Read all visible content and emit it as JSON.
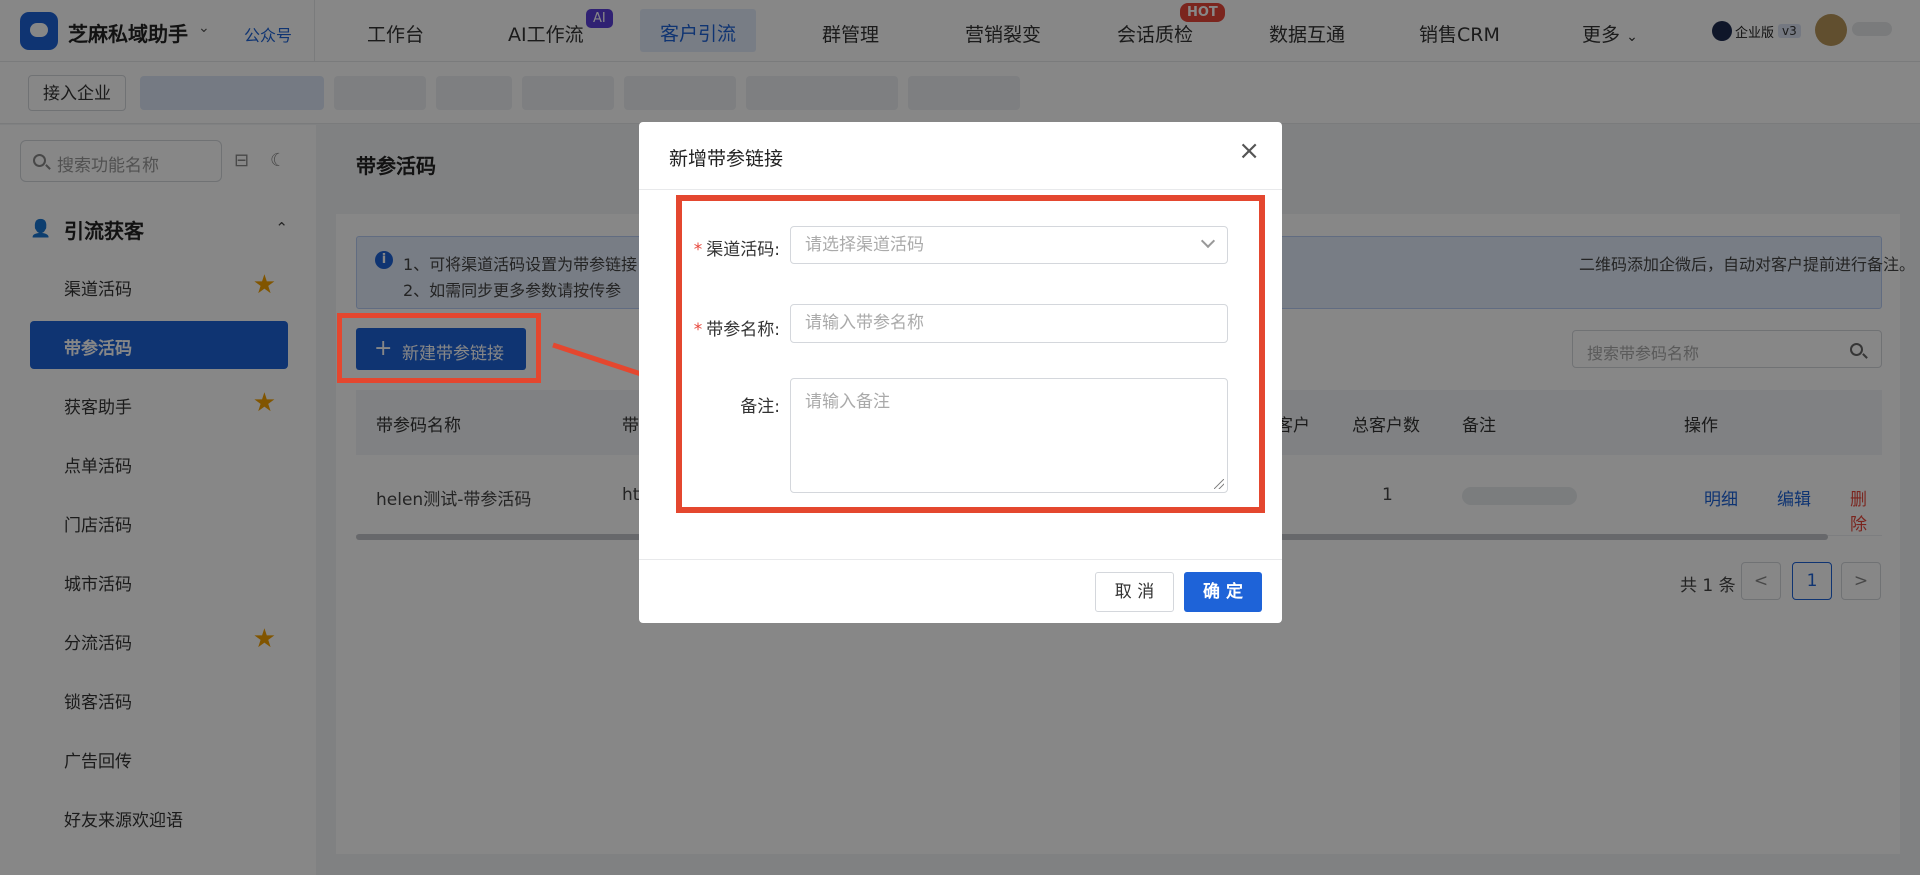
{
  "header": {
    "brand": "芝麻私域助手",
    "official_account": "公众号",
    "nav": [
      "工作台",
      "AI工作流",
      "客户引流",
      "群管理",
      "营销裂变",
      "会话质检",
      "数据互通",
      "销售CRM",
      "更多"
    ],
    "ai_badge": "AI",
    "hot_badge": "HOT",
    "enterprise_label": "企业版",
    "version": "v3"
  },
  "subbar": {
    "join_label": "接入企业"
  },
  "sidebar": {
    "search_placeholder": "搜索功能名称",
    "section_title": "引流获客",
    "items": [
      {
        "label": "渠道活码",
        "starred": true
      },
      {
        "label": "带参活码",
        "active": true
      },
      {
        "label": "获客助手",
        "starred": true
      },
      {
        "label": "点单活码"
      },
      {
        "label": "门店活码"
      },
      {
        "label": "城市活码"
      },
      {
        "label": "分流活码",
        "starred": true
      },
      {
        "label": "锁客活码"
      },
      {
        "label": "广告回传"
      },
      {
        "label": "好友来源欢迎语"
      }
    ]
  },
  "main": {
    "title": "带参活码",
    "info": {
      "line1": "1、可将渠道活码设置为带参链接",
      "line1_tail": "二维码添加企微后，自动对客户提前进行备注。",
      "line2": "2、如需同步更多参数请按传参"
    },
    "new_button": "新建带参链接",
    "search_placeholder": "搜索带参码名称",
    "columns": [
      "带参码名称",
      "带",
      "客户",
      "总客户数",
      "备注",
      "操作"
    ],
    "rows": [
      {
        "name": "helen测试-带参活码",
        "col2": "ht",
        "total": "1",
        "ops": [
          "明细",
          "编辑",
          "删除"
        ]
      }
    ],
    "pagination": {
      "total": "共 1 条",
      "prev": "<",
      "page": "1",
      "next": ">"
    }
  },
  "modal": {
    "title": "新增带参链接",
    "close": "×",
    "fields": [
      {
        "label": "渠道活码:",
        "required": true,
        "placeholder": "请选择渠道活码"
      },
      {
        "label": "带参名称:",
        "required": true,
        "placeholder": "请输入带参名称"
      },
      {
        "label": "备注:",
        "required": false,
        "placeholder": "请输入备注"
      }
    ],
    "required_mark": "*",
    "cancel": "取 消",
    "ok": "确 定"
  },
  "colors": {
    "primary": "#1e63d8",
    "highlight": "#e4472f",
    "star": "#f3a100",
    "danger": "#e8463a"
  }
}
